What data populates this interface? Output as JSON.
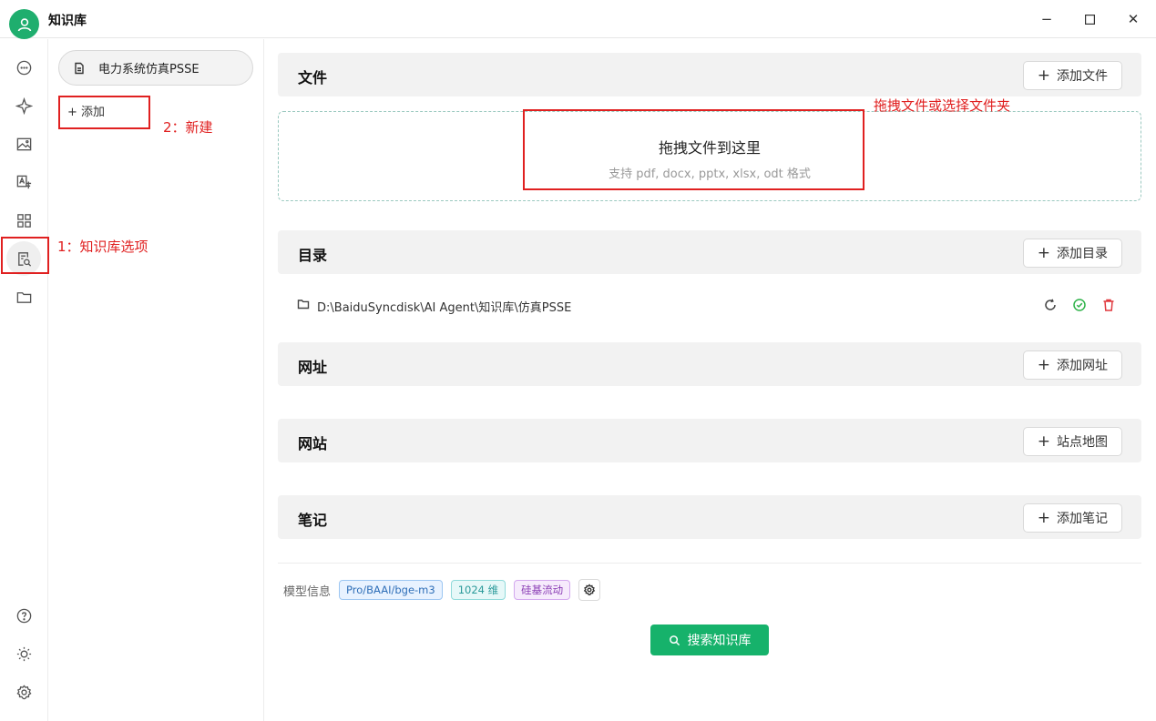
{
  "app": {
    "title": "知识库",
    "window_controls": {
      "minimize": "−",
      "maximize": "☐",
      "close": "✕"
    }
  },
  "rail": {
    "top_icons": [
      "chat-icon",
      "sparkle-icon",
      "image-icon",
      "translate-icon",
      "apps-icon",
      "knowledge-icon",
      "folder-icon"
    ],
    "bottom_icons": [
      "help-icon",
      "theme-icon",
      "settings-icon"
    ],
    "active": "knowledge-icon"
  },
  "kb_list": {
    "items": [
      {
        "label": "电力系统仿真PSSE"
      }
    ],
    "add_label": "+ 添加"
  },
  "annotations": {
    "kb_option": "1：知识库选项",
    "new": "2：新建",
    "drag": "拖拽文件或选择文件夹"
  },
  "sections": {
    "files": {
      "title": "文件",
      "button": "添加文件"
    },
    "dropzone": {
      "title": "拖拽文件到这里",
      "hint": "支持 pdf, docx, pptx, xlsx, odt 格式"
    },
    "directory": {
      "title": "目录",
      "button": "添加目录",
      "path": "D:\\BaiduSyncdisk\\AI Agent\\知识库\\仿真PSSE"
    },
    "url": {
      "title": "网址",
      "button": "添加网址"
    },
    "website": {
      "title": "网站",
      "button": "站点地图"
    },
    "notes": {
      "title": "笔记",
      "button": "添加笔记"
    }
  },
  "model_info": {
    "label": "模型信息",
    "model": "Pro/BAAI/bge-m3",
    "dimensions": "1024 维",
    "provider": "硅基流动"
  },
  "search_button": "搜索知识库",
  "colors": {
    "accent": "#16b26b",
    "annotation": "#e02020",
    "ok": "#2fb34a",
    "danger": "#e0393e"
  }
}
